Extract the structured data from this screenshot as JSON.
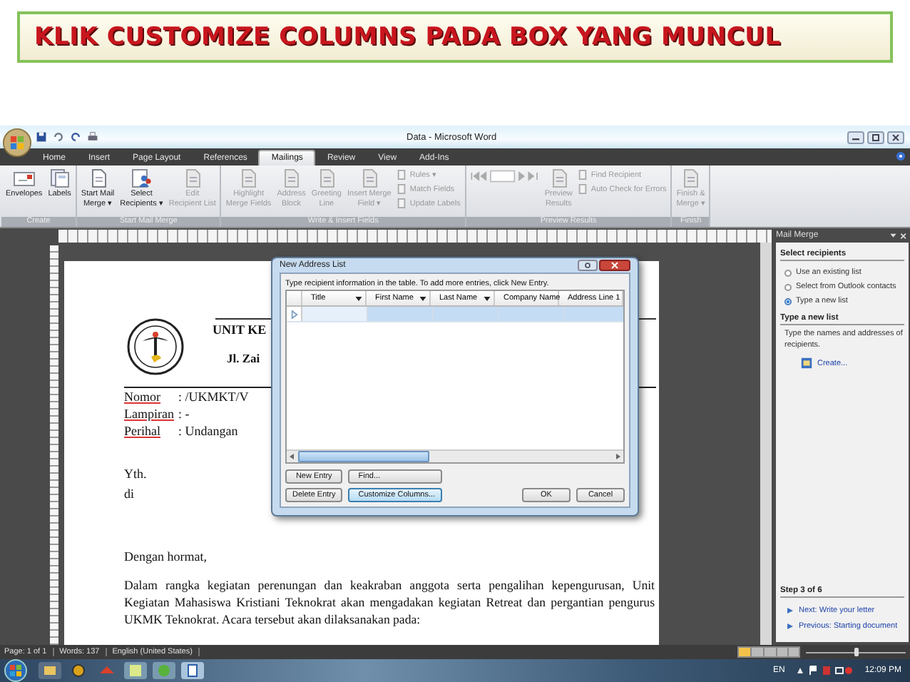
{
  "slide_title": "KLIK CUSTOMIZE COLUMNS PADA BOX YANG MUNCUL",
  "window": {
    "title": "Data - Microsoft Word"
  },
  "tabs": [
    {
      "label": "Home",
      "selected": false
    },
    {
      "label": "Insert",
      "selected": false
    },
    {
      "label": "Page Layout",
      "selected": false
    },
    {
      "label": "References",
      "selected": false
    },
    {
      "label": "Mailings",
      "selected": true
    },
    {
      "label": "Review",
      "selected": false
    },
    {
      "label": "View",
      "selected": false
    },
    {
      "label": "Add-Ins",
      "selected": false
    }
  ],
  "ribbon": {
    "groups": [
      {
        "label": "Create",
        "items": [
          {
            "kind": "envelope",
            "lines": [
              "Envelopes"
            ],
            "disabled": false
          },
          {
            "kind": "labels",
            "lines": [
              "Labels"
            ],
            "disabled": false
          }
        ]
      },
      {
        "label": "Start Mail Merge",
        "items": [
          {
            "kind": "page",
            "lines": [
              "Start Mail",
              "Merge ▾"
            ],
            "disabled": false
          },
          {
            "kind": "people",
            "lines": [
              "Select",
              "Recipients ▾"
            ],
            "disabled": false
          },
          {
            "kind": "page",
            "lines": [
              "Edit",
              "Recipient List"
            ],
            "disabled": true
          }
        ]
      },
      {
        "label": "Write & Insert Fields",
        "items": [
          {
            "kind": "page",
            "lines": [
              "Highlight",
              "Merge Fields"
            ],
            "disabled": true
          },
          {
            "kind": "page",
            "lines": [
              "Address",
              "Block"
            ],
            "disabled": true
          },
          {
            "kind": "page",
            "lines": [
              "Greeting",
              "Line"
            ],
            "disabled": true
          },
          {
            "kind": "page",
            "lines": [
              "Insert Merge",
              "Field ▾"
            ],
            "disabled": true
          },
          {
            "kind": "stack",
            "items": [
              {
                "label": "Rules ▾",
                "disabled": true
              },
              {
                "label": "Match Fields",
                "disabled": true
              },
              {
                "label": "Update Labels",
                "disabled": true
              }
            ]
          }
        ]
      },
      {
        "label": "Preview Results",
        "items": [
          {
            "kind": "page",
            "lines": [
              "Preview",
              "Results"
            ],
            "disabled": true
          },
          {
            "kind": "stack",
            "items": [
              {
                "label": "Find Recipient",
                "disabled": true
              },
              {
                "label": "Auto Check for Errors",
                "disabled": true
              }
            ]
          }
        ]
      },
      {
        "label": "Finish",
        "items": [
          {
            "kind": "page",
            "lines": [
              "Finish &",
              "Merge ▾"
            ],
            "disabled": true
          }
        ]
      }
    ]
  },
  "document": {
    "header": [
      "UNIT KE",
      "Jl. Zai"
    ],
    "fields": [
      {
        "label": "Nomor",
        "value": ": /UKMKT/V"
      },
      {
        "label": "Lampiran",
        "value": ": -"
      },
      {
        "label": "Perihal",
        "value": ": Undangan"
      }
    ],
    "recipient": [
      "Yth.",
      "di"
    ],
    "greeting": "Dengan hormat,",
    "paragraph": [
      "Dalam rangka kegiatan perenungan dan keakraban anggota serta pengalihan kepengurusan, Unit",
      "Kegiatan Mahasiswa Kristiani Teknokrat akan mengadakan kegiatan Retreat dan pergantian pengurus",
      "UKMK Teknokrat. Acara tersebut akan dilaksanakan pada:"
    ]
  },
  "dialog": {
    "title": "New Address List",
    "instruction": "Type recipient information in the table.  To add more entries, click New Entry.",
    "columns": [
      "Title",
      "First Name",
      "Last Name",
      "Company Name",
      "Address Line 1"
    ],
    "rows": [
      {
        "selected": true
      }
    ],
    "entry_buttons": [
      {
        "label": "New Entry",
        "highlighted": false
      },
      {
        "label": "Delete Entry",
        "highlighted": false
      }
    ],
    "column_buttons": [
      {
        "label": "Find...",
        "highlighted": false
      },
      {
        "label": "Customize Columns...",
        "highlighted": true
      }
    ],
    "action_buttons": [
      {
        "label": "OK",
        "highlighted": false
      },
      {
        "label": "Cancel",
        "highlighted": false
      }
    ]
  },
  "task_pane": {
    "title": "Mail Merge",
    "sections": [
      {
        "heading": "Select recipients",
        "options": [
          {
            "label": "Use an existing list",
            "selected": false
          },
          {
            "label": "Select from Outlook contacts",
            "selected": false
          },
          {
            "label": "Type a new list",
            "selected": true
          }
        ]
      },
      {
        "heading": "Type a new list",
        "text": "Type the names and addresses of recipients.",
        "link": "Create..."
      }
    ],
    "step": "Step 3 of 6",
    "nav": [
      "Next: Write your letter",
      "Previous: Starting document"
    ]
  },
  "status_bar": {
    "items": [
      "Page: 1 of 1",
      "Words: 137",
      "English (United States)"
    ],
    "zoom": {
      "level": 0.5
    }
  },
  "taskbar": {
    "language": "EN",
    "clock": "12:09 PM"
  }
}
